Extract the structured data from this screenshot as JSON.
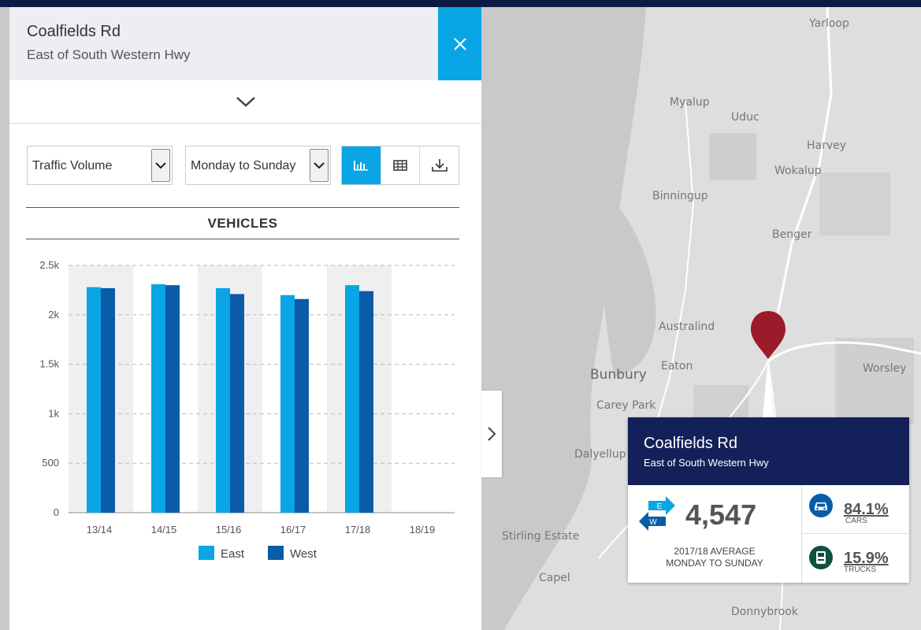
{
  "panel": {
    "title": "Coalfields Rd",
    "subtitle": "East of South Western Hwy",
    "close_icon": "close-icon",
    "collapse_icon": "chevron-down-icon"
  },
  "controls": {
    "metric_select": "Traffic Volume",
    "days_select": "Monday to Sunday",
    "view_buttons": [
      "bar-chart-icon",
      "table-icon",
      "download-icon"
    ],
    "active_view": "bar-chart-icon"
  },
  "chart_heading": "VEHICLES",
  "chart_data": {
    "type": "bar",
    "categories": [
      "13/14",
      "14/15",
      "15/16",
      "16/17",
      "17/18",
      "18/19"
    ],
    "series": [
      {
        "name": "East",
        "color": "#0aa5e4",
        "values": [
          2280,
          2310,
          2270,
          2200,
          2300,
          null
        ]
      },
      {
        "name": "West",
        "color": "#0a5ca8",
        "values": [
          2270,
          2300,
          2210,
          2160,
          2240,
          null
        ]
      }
    ],
    "ylim": [
      0,
      2500
    ],
    "yticks": [
      "0",
      "500",
      "1k",
      "1.5k",
      "2k",
      "2.5k"
    ],
    "grid": true,
    "legend": "bottom"
  },
  "map_labels": [
    "Yarloop",
    "Myalup",
    "Uduc",
    "Harvey",
    "Wokalup",
    "Binningup",
    "Benger",
    "Australind",
    "Eaton",
    "Bunbury",
    "Worsley",
    "Carey Park",
    "Dalyellup",
    "Stirling Estate",
    "Capel",
    "Donnybrook"
  ],
  "info_card": {
    "title": "Coalfields Rd",
    "subtitle": "East of South Western Hwy",
    "direction_badge": [
      "E",
      "W"
    ],
    "total": "4,547",
    "caption_line1": "2017/18 AVERAGE",
    "caption_line2": "MONDAY TO SUNDAY",
    "cars_pct": "84.1%",
    "cars_label": "CARS",
    "trucks_pct": "15.9%",
    "trucks_label": "TRUCKS"
  },
  "colors": {
    "accent": "#0aa5e4",
    "west": "#0a5ca8",
    "info_header": "#14205a",
    "marker": "#9b1b2b",
    "frame": "#0c1b44"
  }
}
